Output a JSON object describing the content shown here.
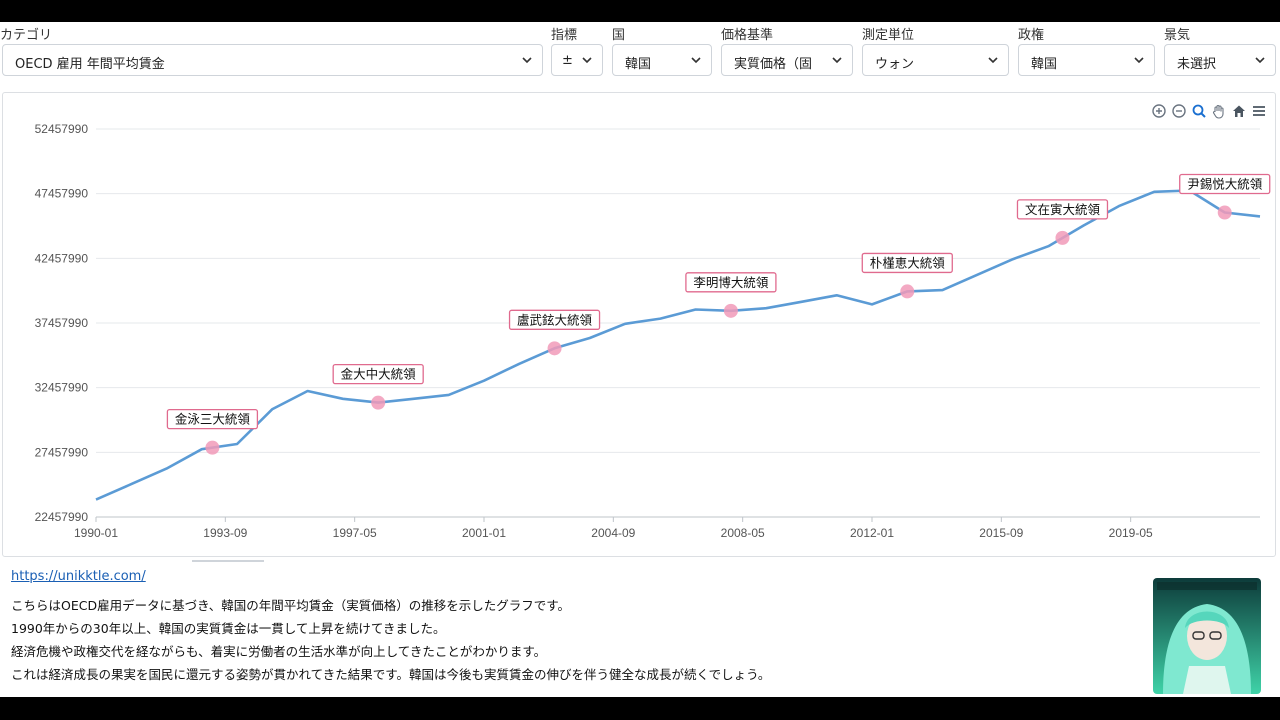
{
  "filters": [
    {
      "label": "カテゴリ",
      "value": "OECD 雇用 年間平均賃金"
    },
    {
      "label": "指標",
      "value": "±"
    },
    {
      "label": "国",
      "value": "韓国"
    },
    {
      "label": "価格基準",
      "value": "実質価格（固"
    },
    {
      "label": "測定単位",
      "value": "ウォン"
    },
    {
      "label": "政権",
      "value": "韓国"
    },
    {
      "label": "景気",
      "value": "未選択"
    }
  ],
  "toolbar_icons": [
    "zoom-in-icon",
    "zoom-out-icon",
    "magnifier-icon",
    "pan-hand-icon",
    "home-icon",
    "menu-icon"
  ],
  "chart_data": {
    "type": "line",
    "x_ticks": [
      "1990-01",
      "1993-09",
      "1997-05",
      "2001-01",
      "2004-09",
      "2008-05",
      "2012-01",
      "2015-09",
      "2019-05"
    ],
    "y_ticks": [
      "22457990",
      "27457990",
      "32457990",
      "37457990",
      "42457990",
      "47457990",
      "52457990"
    ],
    "ylim": [
      22457990,
      52457990
    ],
    "xlim_years": [
      1990,
      2023
    ],
    "color": "#5b9bd5",
    "series": [
      {
        "points": [
          [
            1990,
            23800000
          ],
          [
            1991,
            25000000
          ],
          [
            1992,
            26200000
          ],
          [
            1993,
            27700000
          ],
          [
            1994,
            28100000
          ],
          [
            1995,
            30800000
          ],
          [
            1996,
            32200000
          ],
          [
            1997,
            31600000
          ],
          [
            1998,
            31300000
          ],
          [
            1999,
            31600000
          ],
          [
            2000,
            31900000
          ],
          [
            2001,
            33000000
          ],
          [
            2002,
            34300000
          ],
          [
            2003,
            35500000
          ],
          [
            2004,
            36300000
          ],
          [
            2005,
            37400000
          ],
          [
            2006,
            37800000
          ],
          [
            2007,
            38500000
          ],
          [
            2008,
            38400000
          ],
          [
            2009,
            38600000
          ],
          [
            2010,
            39100000
          ],
          [
            2011,
            39600000
          ],
          [
            2012,
            38900000
          ],
          [
            2013,
            39900000
          ],
          [
            2014,
            40000000
          ],
          [
            2015,
            41200000
          ],
          [
            2016,
            42400000
          ],
          [
            2017,
            43400000
          ],
          [
            2018,
            45000000
          ],
          [
            2019,
            46500000
          ],
          [
            2020,
            47600000
          ],
          [
            2021,
            47700000
          ],
          [
            2022,
            46000000
          ],
          [
            2023,
            45700000
          ]
        ]
      }
    ],
    "annotations": [
      {
        "label": "金泳三大統領",
        "year": 1993.3
      },
      {
        "label": "金大中大統領",
        "year": 1998.0
      },
      {
        "label": "盧武鉉大統領",
        "year": 2003.0
      },
      {
        "label": "李明博大統領",
        "year": 2008.0
      },
      {
        "label": "朴槿恵大統領",
        "year": 2013.0
      },
      {
        "label": "文在寅大統領",
        "year": 2017.4
      },
      {
        "label": "尹錫悦大統領",
        "year": 2022.0
      }
    ],
    "marker_color": "#f19ab8",
    "annotation_border": "#e06a8e"
  },
  "source_link": "https://unikktle.com/",
  "description": [
    "こちらはOECD雇用データに基づき、韓国の年間平均賃金（実質価格）の推移を示したグラフです。",
    "1990年からの30年以上、韓国の実質賃金は一貫して上昇を続けてきました。",
    "経済危機や政権交代を経ながらも、着実に労働者の生活水準が向上してきたことがわかります。",
    "これは経済成長の果実を国民に還元する姿勢が貫かれてきた結果です。韓国は今後も実質賃金の伸びを伴う健全な成長が続くでしょう。"
  ]
}
